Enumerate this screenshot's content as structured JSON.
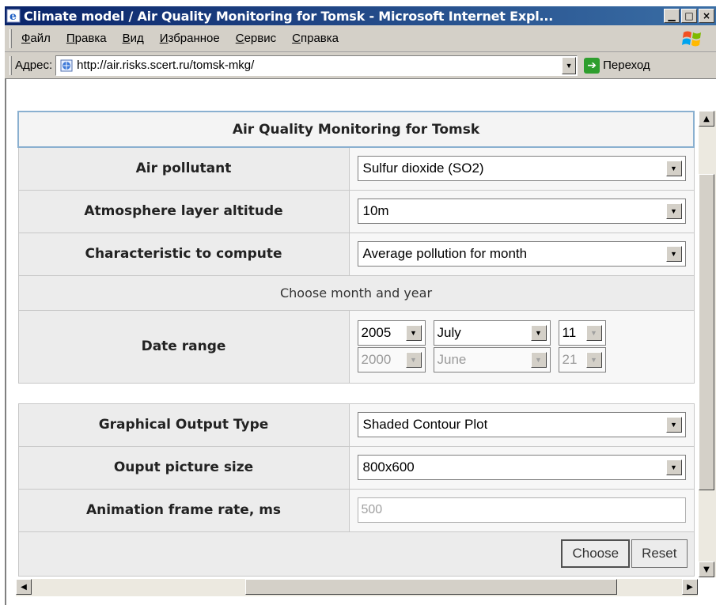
{
  "window": {
    "title": "Climate model / Air Quality Monitoring for Tomsk - Microsoft Internet Expl...",
    "minimize_glyph": "▁",
    "maximize_glyph": "□",
    "close_glyph": "×"
  },
  "menubar": {
    "items": [
      "Файл",
      "Правка",
      "Вид",
      "Избранное",
      "Сервис",
      "Справка"
    ]
  },
  "addressbar": {
    "label": "Адрес:",
    "url": "http://air.risks.scert.ru/tomsk-mkg/",
    "go_label": "Переход"
  },
  "form": {
    "title": "Air Quality Monitoring for Tomsk",
    "pollutant": {
      "label": "Air pollutant",
      "value": "Sulfur dioxide (SO2)"
    },
    "altitude": {
      "label": "Atmosphere layer altitude",
      "value": "10m"
    },
    "characteristic": {
      "label": "Characteristic to compute",
      "value": "Average pollution for month"
    },
    "choose_heading": "Choose month and year",
    "date_range": {
      "label": "Date range",
      "start": {
        "year": "2005",
        "month": "July",
        "day": "11"
      },
      "end": {
        "year": "2000",
        "month": "June",
        "day": "21"
      }
    },
    "output_type": {
      "label": "Graphical Output Type",
      "value": "Shaded Contour Plot"
    },
    "picture_size": {
      "label": "Ouput picture size",
      "value": "800x600"
    },
    "frame_rate": {
      "label": "Animation frame rate, ms",
      "value": "500"
    },
    "buttons": {
      "choose": "Choose",
      "reset": "Reset"
    }
  },
  "colors": {
    "title_bar_start": "#0a246a",
    "title_bar_end": "#3a6ea5",
    "header_border": "#8ab0d0",
    "chrome": "#d4d0c8"
  }
}
